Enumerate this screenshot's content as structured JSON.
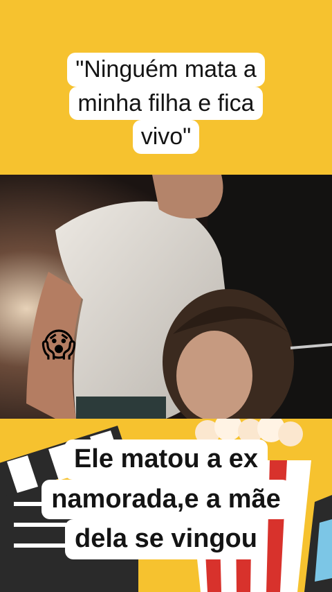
{
  "top_caption": {
    "line1": "\"Ninguém mata a",
    "line2": "minha filha e fica",
    "line3": "vivo\""
  },
  "emoji": {
    "glyph": "😱",
    "name": "screaming-face-emoji"
  },
  "bottom_caption": {
    "line1": "Ele matou a ex",
    "line2": "namorada,e a mãe",
    "line3": "dela se vingou"
  },
  "colors": {
    "background": "#f6c22f",
    "caption_bg": "#ffffff",
    "caption_text": "#141414",
    "popcorn_red": "#d8322c",
    "clapper_dark": "#2a2a2a"
  }
}
